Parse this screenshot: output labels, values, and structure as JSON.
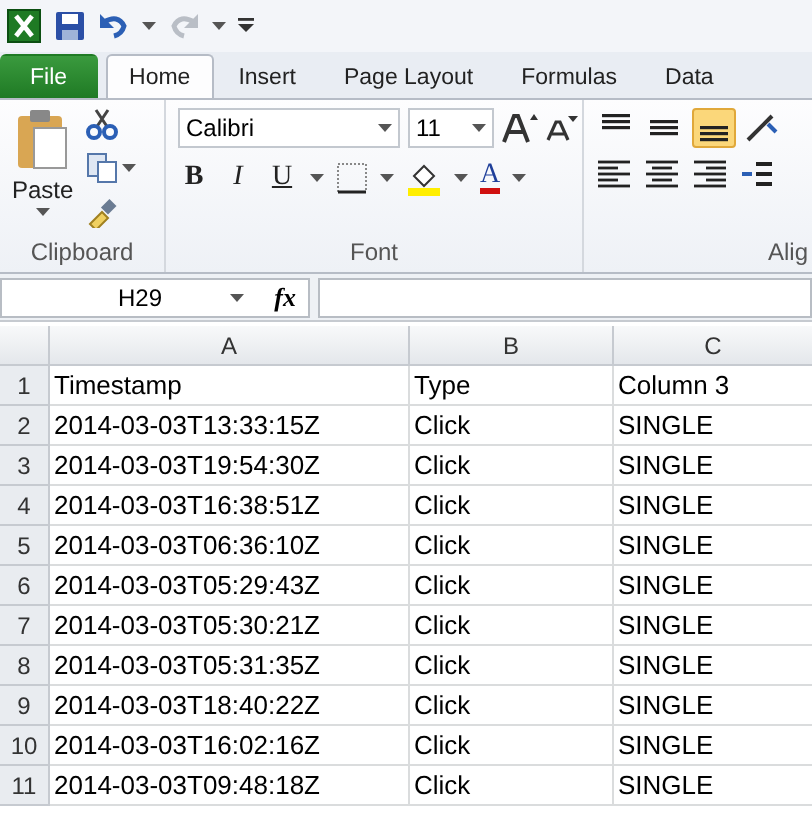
{
  "tabs": [
    {
      "label": "File",
      "kind": "file",
      "selected": false
    },
    {
      "label": "Home",
      "kind": "tab",
      "selected": true
    },
    {
      "label": "Insert",
      "kind": "tab",
      "selected": false
    },
    {
      "label": "Page Layout",
      "kind": "tab",
      "selected": false
    },
    {
      "label": "Formulas",
      "kind": "tab",
      "selected": false
    },
    {
      "label": "Data",
      "kind": "tab",
      "selected": false
    }
  ],
  "clipboard": {
    "paste_label": "Paste",
    "group_label": "Clipboard"
  },
  "font": {
    "name": "Calibri",
    "size": "11",
    "bold": "B",
    "italic": "I",
    "underline": "U",
    "font_color": "A",
    "group_label": "Font"
  },
  "alignment": {
    "group_label": "Alig"
  },
  "formula_bar": {
    "name_box": "H29",
    "fx": "fx"
  },
  "columns": [
    "A",
    "B",
    "C"
  ],
  "rows": [
    {
      "number": "1",
      "cells": [
        "Timestamp",
        "Type",
        "Column 3"
      ]
    },
    {
      "number": "2",
      "cells": [
        "2014-03-03T13:33:15Z",
        "Click",
        "SINGLE"
      ]
    },
    {
      "number": "3",
      "cells": [
        "2014-03-03T19:54:30Z",
        "Click",
        "SINGLE"
      ]
    },
    {
      "number": "4",
      "cells": [
        "2014-03-03T16:38:51Z",
        "Click",
        "SINGLE"
      ]
    },
    {
      "number": "5",
      "cells": [
        "2014-03-03T06:36:10Z",
        "Click",
        "SINGLE"
      ]
    },
    {
      "number": "6",
      "cells": [
        "2014-03-03T05:29:43Z",
        "Click",
        "SINGLE"
      ]
    },
    {
      "number": "7",
      "cells": [
        "2014-03-03T05:30:21Z",
        "Click",
        "SINGLE"
      ]
    },
    {
      "number": "8",
      "cells": [
        "2014-03-03T05:31:35Z",
        "Click",
        "SINGLE"
      ]
    },
    {
      "number": "9",
      "cells": [
        "2014-03-03T18:40:22Z",
        "Click",
        "SINGLE"
      ]
    },
    {
      "number": "10",
      "cells": [
        "2014-03-03T16:02:16Z",
        "Click",
        "SINGLE"
      ]
    },
    {
      "number": "11",
      "cells": [
        "2014-03-03T09:48:18Z",
        "Click",
        "SINGLE"
      ]
    }
  ]
}
